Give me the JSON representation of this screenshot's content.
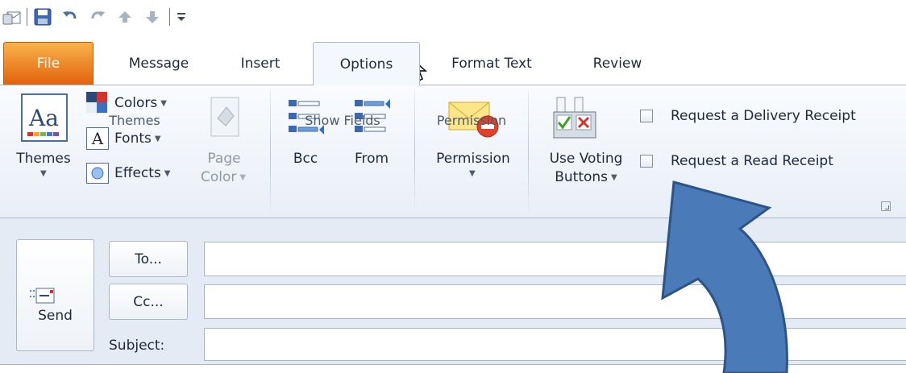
{
  "quick_access": {
    "icons": [
      "outlook-app-icon",
      "save-icon",
      "undo-icon",
      "redo-icon",
      "previous-item-icon",
      "next-item-icon",
      "customize-toolbar-icon"
    ]
  },
  "tabs": [
    {
      "label": "File",
      "state": "file"
    },
    {
      "label": "Message",
      "state": "normal"
    },
    {
      "label": "Insert",
      "state": "normal"
    },
    {
      "label": "Options",
      "state": "selected"
    },
    {
      "label": "Format Text",
      "state": "normal"
    },
    {
      "label": "Review",
      "state": "normal"
    }
  ],
  "ribbon": {
    "themes_group": {
      "themes_label": "Themes",
      "colors_label": "Colors",
      "fonts_label": "Fonts",
      "effects_label": "Effects",
      "page_label": "Page",
      "color_label": "Color",
      "group_label": "Themes"
    },
    "show_fields_group": {
      "bcc_label": "Bcc",
      "from_label": "From",
      "group_label": "Show Fields"
    },
    "permission_group": {
      "permission_label": "Permission",
      "group_label": "Permission"
    },
    "tracking_group": {
      "voting_label_line1": "Use Voting",
      "voting_label_line2": "Buttons",
      "delivery_receipt_label": "Request a Delivery Receipt",
      "delivery_receipt_checked": false,
      "read_receipt_label": "Request a Read Receipt",
      "read_receipt_checked": false
    }
  },
  "compose": {
    "send_label": "Send",
    "to_label": "To...",
    "cc_label": "Cc...",
    "subject_label": "Subject:",
    "to_value": "",
    "cc_value": "",
    "subject_value": ""
  },
  "colors": {
    "file_tab": "#e2620c",
    "ribbon_bg": "#e9eff7",
    "compose_bg": "#e4ebf4",
    "annotation_arrow": "#4a7ab8"
  }
}
